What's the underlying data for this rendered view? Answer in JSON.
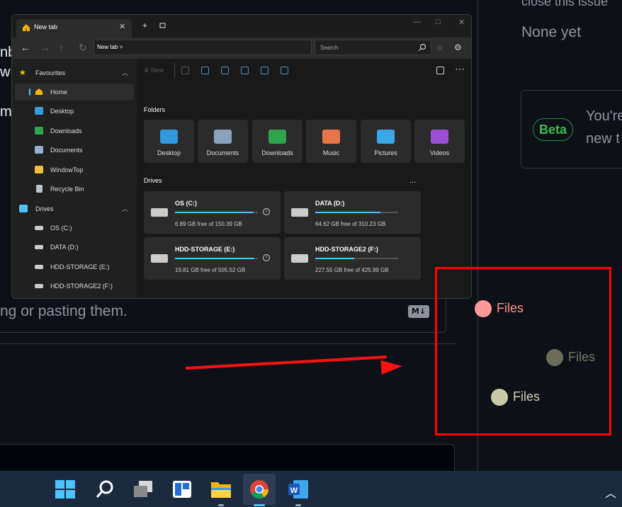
{
  "background_page": {
    "left_letters": [
      "nb",
      "w",
      "",
      "m"
    ],
    "hint_text": "ng or pasting them.",
    "markdown_badge": "M↓",
    "top_right_text": "close this issue",
    "none_yet": "None yet",
    "beta": {
      "badge": "Beta",
      "line1": "You're",
      "line2": "new t"
    }
  },
  "explorer": {
    "tab_title": "New tab",
    "tab_close": "✕",
    "tab_add": "+",
    "address": "New tab  >",
    "search_placeholder": "Search",
    "toolbar": {
      "new_label": "New"
    },
    "sidebar": {
      "favourites": "Favourites",
      "items": [
        "Home",
        "Desktop",
        "Downloads",
        "Documents",
        "WindowTop",
        "Recycle Bin"
      ],
      "drives_section": "Drives",
      "drive_items": [
        "OS (C:)",
        "DATA (D:)",
        "HDD-STORAGE (E:)",
        "HDD-STORAGE2 (F:)"
      ]
    },
    "folders_title": "Folders",
    "folders": [
      "Desktop",
      "Documents",
      "Downloads",
      "Music",
      "Pictures",
      "Videos"
    ],
    "drives_title": "Drives",
    "drives": [
      {
        "name": "OS (C:)",
        "free": "6.89 GB free of 150.39 GB",
        "used_fraction": 0.95
      },
      {
        "name": "DATA (D:)",
        "free": "64.62 GB free of 310.23 GB",
        "used_fraction": 0.79
      },
      {
        "name": "HDD-STORAGE (E:)",
        "free": "19.81 GB free of 505.52 GB",
        "used_fraction": 0.96
      },
      {
        "name": "HDD-STORAGE2 (F:)",
        "free": "227.55 GB free of 425.99 GB",
        "used_fraction": 0.47
      }
    ],
    "more_dots": "..."
  },
  "annotation": {
    "labels": [
      "Files",
      "Files",
      "Files"
    ],
    "colors": {
      "box": "#ff0000",
      "dot1": "#ff9a9a",
      "dot2": "#6b6d5a",
      "dot3": "#c9c9a8"
    }
  },
  "taskbar": {
    "icons": [
      "windows-start-icon",
      "search-icon",
      "task-view-icon",
      "widgets-icon",
      "file-explorer-icon",
      "chrome-icon",
      "word-icon"
    ]
  }
}
